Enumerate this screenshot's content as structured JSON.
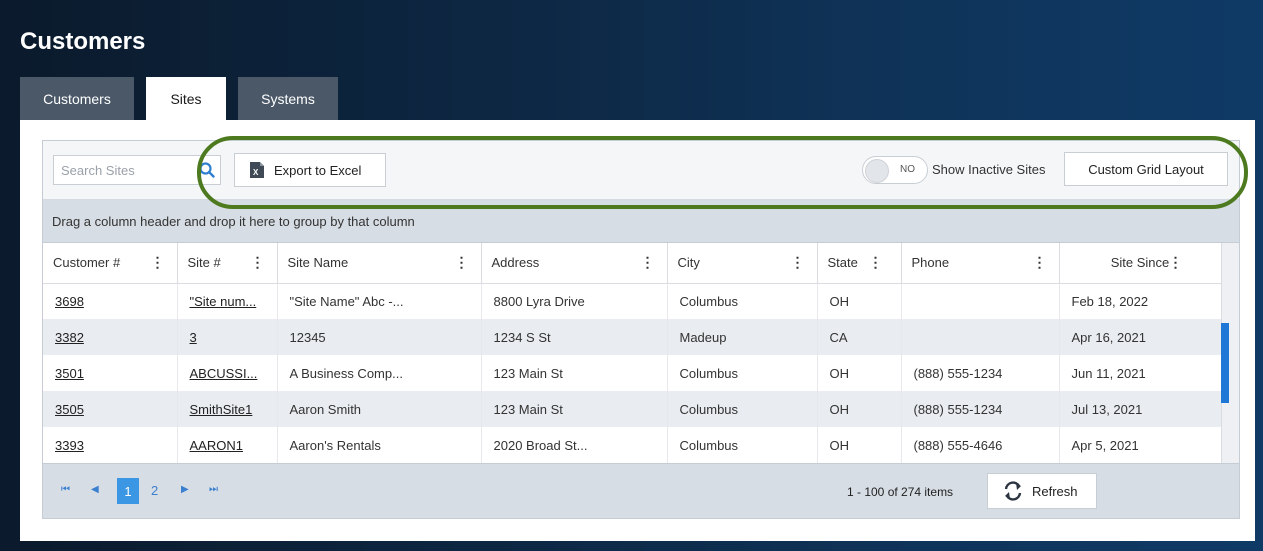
{
  "page": {
    "title": "Customers"
  },
  "tabs": [
    {
      "label": "Customers",
      "active": false
    },
    {
      "label": "Sites",
      "active": true
    },
    {
      "label": "Systems",
      "active": false
    }
  ],
  "toolbar": {
    "search_placeholder": "Search Sites",
    "search_icon": "search-icon",
    "export_label": "Export to Excel",
    "export_icon": "excel-icon",
    "toggle_state": "NO",
    "show_inactive_label": "Show Inactive Sites",
    "custom_layout_label": "Custom Grid Layout"
  },
  "group_hint": "Drag a column header and drop it here to group by that column",
  "columns": [
    "Customer #",
    "Site #",
    "Site Name",
    "Address",
    "City",
    "State",
    "Phone",
    "Site Since"
  ],
  "rows": [
    [
      "3698",
      "\"Site num...",
      "\"Site Name\" Abc -...",
      "8800 Lyra Drive",
      "Columbus",
      "OH",
      "",
      "Feb 18, 2022"
    ],
    [
      "3382",
      "3",
      "12345",
      "1234 S St",
      "Madeup",
      "CA",
      "",
      "Apr 16, 2021"
    ],
    [
      "3501",
      "ABCUSSI...",
      "A Business Comp...",
      "123 Main St",
      "Columbus",
      "OH",
      "(888) 555-1234",
      "Jun 11, 2021"
    ],
    [
      "3505",
      "SmithSite1",
      "Aaron Smith",
      "123 Main St",
      "Columbus",
      "OH",
      "(888) 555-1234",
      "Jul 13, 2021"
    ],
    [
      "3393",
      "AARON1",
      "Aaron's Rentals",
      "2020 Broad St...",
      "Columbus",
      "OH",
      "(888) 555-4646",
      "Apr 5, 2021"
    ]
  ],
  "pager": {
    "first": "⏮",
    "prev": "◀",
    "current_page": "1",
    "next_page": "2",
    "next": "▶",
    "last": "⏭",
    "items_info": "1 - 100 of 274 items",
    "refresh_label": "Refresh"
  },
  "colors": {
    "accent": "#3b97e3",
    "highlight_ring": "#4d7a1e",
    "header_bg": "#0d2743"
  }
}
